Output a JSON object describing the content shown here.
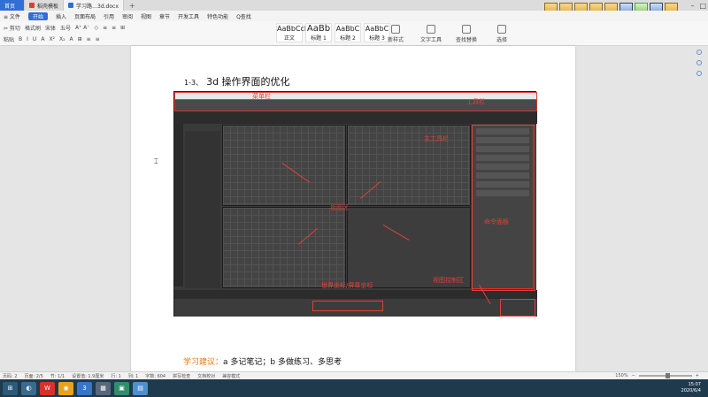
{
  "tabs": {
    "home": "首页",
    "tab1": "稻壳模板",
    "tab2": "学习路…3d.docx",
    "new_tab": "+"
  },
  "menu": {
    "items": [
      "≡ 文件",
      "开始",
      "插入",
      "页面布局",
      "引用",
      "审阅",
      "视图",
      "章节",
      "开发工具",
      "特色功能",
      "Q查找"
    ]
  },
  "ribbon": {
    "row1": [
      "✂ 剪切",
      "格式刷",
      "宋体",
      "五号",
      "A⁺ A⁻",
      "◇",
      "≡",
      "≡",
      "⊞"
    ],
    "row2": [
      "粘贴",
      "B",
      "I",
      "U",
      "A",
      "X²",
      "X₂",
      "A",
      "⊞",
      "≡",
      "≡"
    ],
    "styles": [
      {
        "preview": "AaBbCcDd",
        "name": "正文"
      },
      {
        "preview": "AaBb",
        "name": "标题 1"
      },
      {
        "preview": "AaBbC",
        "name": "标题 2"
      },
      {
        "preview": "AaBbC",
        "name": "标题 3"
      }
    ],
    "tools": [
      "新样式",
      "文字工具",
      "查找替换",
      "选择"
    ]
  },
  "document": {
    "heading_num": "1-3、",
    "heading_text": "3d 操作界面的优化",
    "tip_label": "学习建议：",
    "tip_text": "a 多记笔记；b 多做练习、多思考"
  },
  "annotations": {
    "menubar": "菜单栏",
    "toolbar": "工具栏",
    "main_toolbar": "主工具栏",
    "viewport": "视图区",
    "command_panel": "命令面板",
    "coords": "世界坐标/屏幕坐标",
    "viewport_nav": "视图控制区"
  },
  "statusbar": {
    "page": "页码: 2",
    "pages": "页面: 2/5",
    "section": "节: 1/1",
    "setting": "设置值: 1.9厘米",
    "line": "行: 1",
    "col": "列: 1",
    "words": "字数: 604",
    "spell": "拼写检查",
    "proof": "文档校对",
    "mode": "兼容模式",
    "zoom": "150%"
  },
  "clock": {
    "time": "15:07",
    "date": "2020/6/4"
  }
}
